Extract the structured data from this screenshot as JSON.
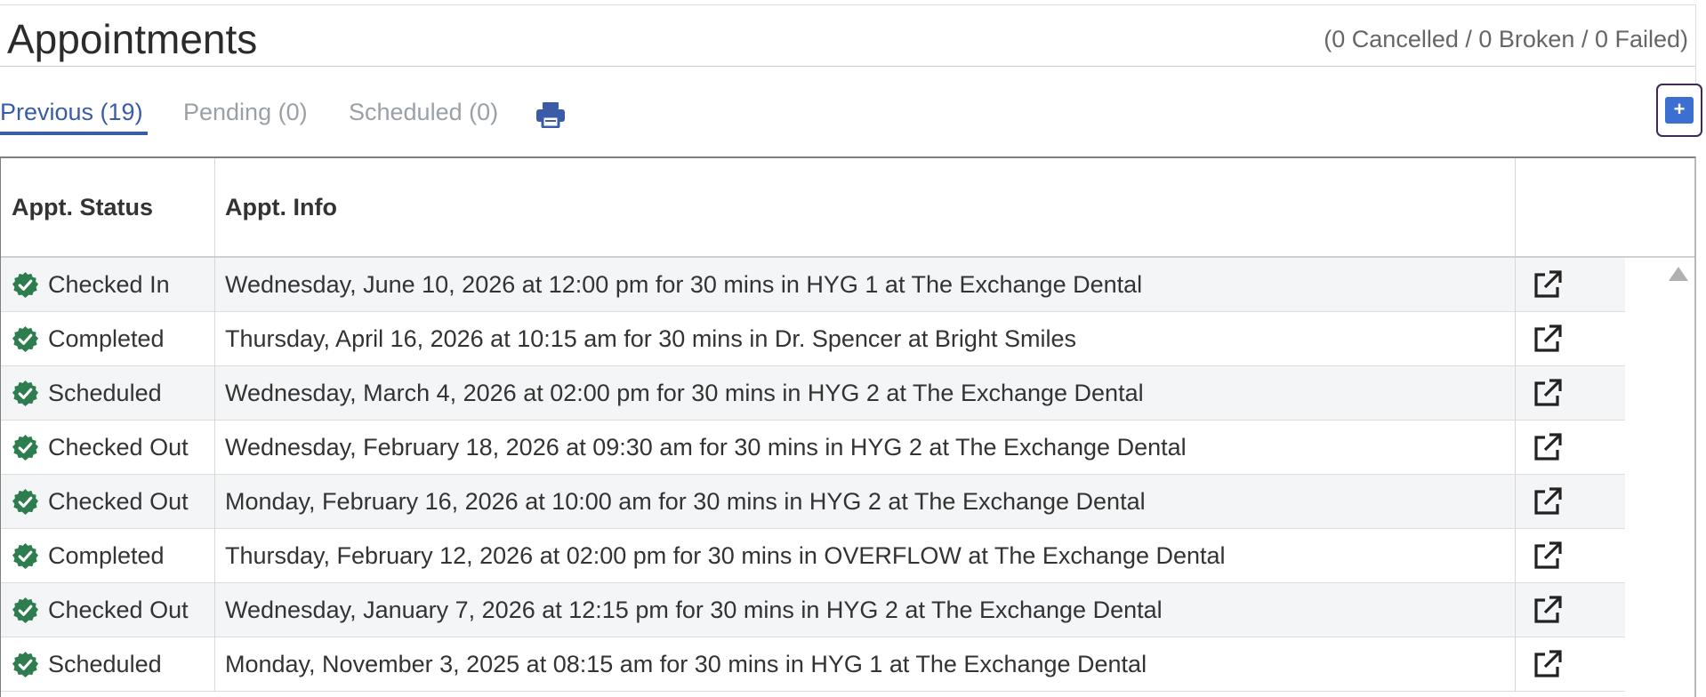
{
  "page": {
    "title": "Appointments",
    "summary": "(0 Cancelled / 0 Broken / 0 Failed)"
  },
  "tabs": [
    {
      "label": "Previous (19)",
      "active": true
    },
    {
      "label": "Pending (0)",
      "active": false
    },
    {
      "label": "Scheduled (0)",
      "active": false
    }
  ],
  "toolbar": {
    "print_icon": "printer-icon",
    "add_label": "+"
  },
  "table": {
    "headers": {
      "status": "Appt. Status",
      "info": "Appt. Info",
      "action": ""
    },
    "rows": [
      {
        "status": "Checked In",
        "info": "Wednesday, June 10, 2026 at 12:00 pm for 30 mins in HYG 1 at The Exchange Dental"
      },
      {
        "status": "Completed",
        "info": "Thursday, April 16, 2026 at 10:15 am for 30 mins in Dr. Spencer at Bright Smiles"
      },
      {
        "status": "Scheduled",
        "info": "Wednesday, March 4, 2026 at 02:00 pm for 30 mins in HYG 2 at The Exchange Dental"
      },
      {
        "status": "Checked Out",
        "info": "Wednesday, February 18, 2026 at 09:30 am for 30 mins in HYG 2 at The Exchange Dental"
      },
      {
        "status": "Checked Out",
        "info": "Monday, February 16, 2026 at 10:00 am for 30 mins in HYG 2 at The Exchange Dental"
      },
      {
        "status": "Completed",
        "info": "Thursday, February 12, 2026 at 02:00 pm for 30 mins in OVERFLOW at The Exchange Dental"
      },
      {
        "status": "Checked Out",
        "info": "Wednesday, January 7, 2026 at 12:15 pm for 30 mins in HYG 2 at The Exchange Dental"
      },
      {
        "status": "Scheduled",
        "info": "Monday, November 3, 2025 at 08:15 am for 30 mins in HYG 1 at The Exchange Dental"
      }
    ]
  },
  "colors": {
    "accent": "#3a5ca8",
    "add_button": "#3b6fd1",
    "status_check": "#2e7d4f",
    "inactive_tab": "#9aa0a6"
  },
  "icons": {
    "status": "check-circle-icon",
    "open": "external-link-icon",
    "scroll_up": "scroll-up-arrow-icon"
  }
}
